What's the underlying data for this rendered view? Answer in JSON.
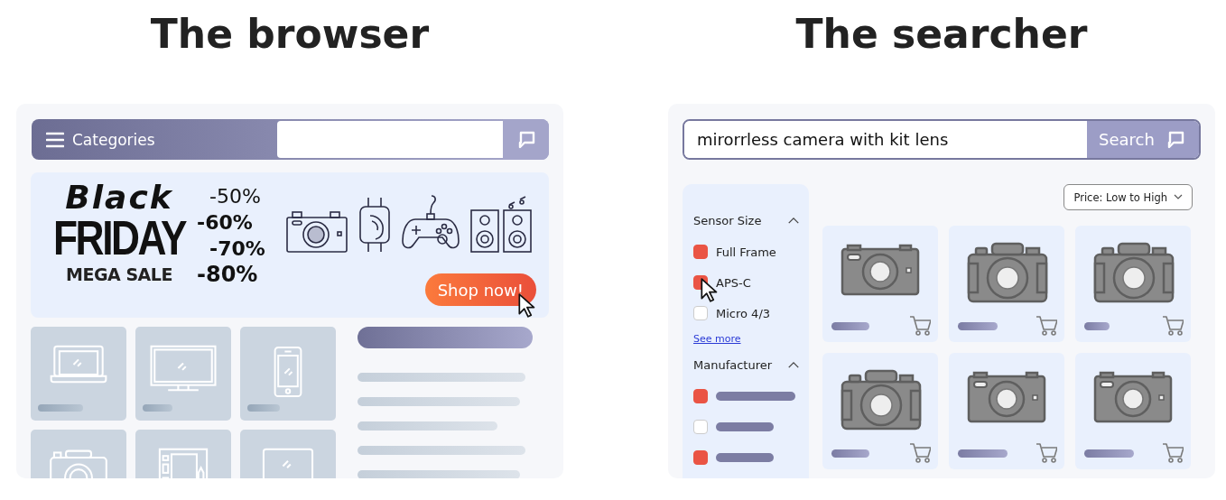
{
  "panels": [
    {
      "kind": "browser",
      "heading": "The browser",
      "nav": {
        "menu_label": "Categories"
      },
      "banner": {
        "line_1": "Black",
        "line_2": "FRIDAY",
        "line_3": "MEGA SALE",
        "discounts": [
          "-50%",
          "-60%",
          "-70%",
          "-80%"
        ],
        "button": "Shop now!"
      }
    },
    {
      "kind": "searcher",
      "heading": "The searcher",
      "search": {
        "value": "mirorrless camera with kit lens",
        "button": "Search"
      },
      "sort": "Price: Low to High",
      "filters": [
        {
          "title": "Sensor Size",
          "expanded": true,
          "link": "See more",
          "options": [
            {
              "label": "Full Frame",
              "checked": true
            },
            {
              "label": "APS-C",
              "checked": true,
              "pointer": true
            },
            {
              "label": "Micro 4/3",
              "checked": false
            }
          ]
        },
        {
          "title": "Manufacturer",
          "expanded": true,
          "options": [
            {
              "checked": true
            },
            {
              "checked": false
            },
            {
              "checked": true
            }
          ]
        }
      ]
    }
  ]
}
